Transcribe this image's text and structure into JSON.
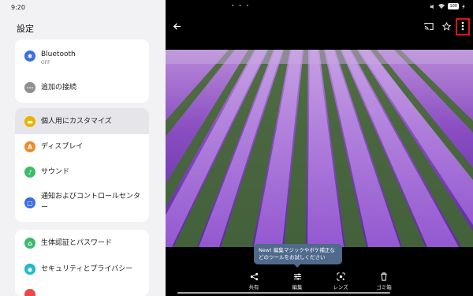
{
  "status": {
    "time": "9:20",
    "battery": "100"
  },
  "settings": {
    "title": "設定",
    "items": [
      {
        "label": "Bluetooth",
        "sub": "OFF",
        "icon": "bluetooth-icon",
        "color": "#3b6de0"
      },
      {
        "label": "追加の接続",
        "icon": "more-horiz-icon",
        "color": "#8e8e93"
      },
      {
        "label": "個人用にカスタマイズ",
        "icon": "palette-icon",
        "color": "#e8b400"
      },
      {
        "label": "ディスプレイ",
        "icon": "display-icon",
        "color": "#f08a2d"
      },
      {
        "label": "サウンド",
        "icon": "sound-icon",
        "color": "#3dbb6b"
      },
      {
        "label": "通知およびコントロールセンター",
        "icon": "notification-icon",
        "color": "#3b6de0"
      },
      {
        "label": "生体認証とパスワード",
        "icon": "lock-icon",
        "color": "#3dbb6b"
      },
      {
        "label": "セキュリティとプライバシー",
        "icon": "shield-icon",
        "color": "#1fb8c8"
      }
    ]
  },
  "viewer": {
    "tooltip": "New! 編集マジックやボケ補正などのツールをお試しください",
    "actions": [
      {
        "label": "共有",
        "icon": "share-icon"
      },
      {
        "label": "編集",
        "icon": "tune-icon"
      },
      {
        "label": "レンズ",
        "icon": "lens-icon"
      },
      {
        "label": "ゴミ箱",
        "icon": "trash-icon"
      }
    ]
  }
}
